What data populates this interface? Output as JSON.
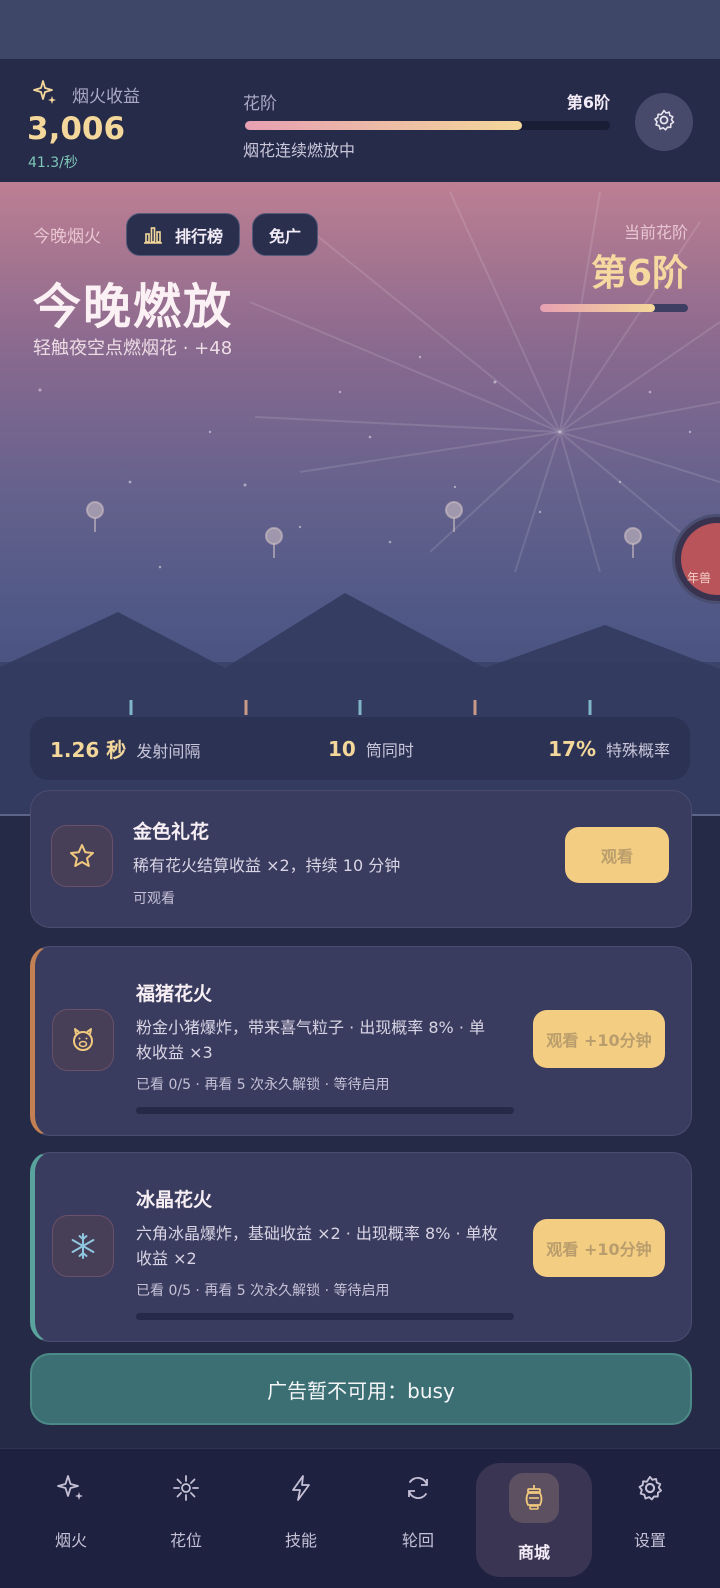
{
  "header": {
    "earnings_label": "烟火收益",
    "earnings_value": "3,006",
    "earnings_rate": "41.3/秒",
    "stage_title": "花阶",
    "stage_level": "第6阶",
    "stage_progress": 0.76,
    "stage_note": "烟花连续燃放中",
    "settings_icon": "gear-icon"
  },
  "hero": {
    "label": "今晚烟火",
    "leaderboard_label": "排行榜",
    "adfree_label": "免广",
    "title": "今晚燃放",
    "subtitle": "轻触夜空点燃烟花 · +48",
    "current_stage_label": "当前花阶",
    "current_stage_value": "第6阶",
    "current_stage_progress": 0.78,
    "float_badge_text": "年兽",
    "stats": [
      {
        "value": "1.26 秒",
        "label": "发射间隔"
      },
      {
        "value": "10",
        "label": "筒同时"
      },
      {
        "value": "17%",
        "label": "特殊概率"
      }
    ]
  },
  "cards": [
    {
      "title": "金色礼花",
      "icon": "star-icon",
      "desc_lines": [
        "稀有花火结算收益 ×2，持续 10 分钟"
      ],
      "meta": "可观看",
      "button": "观看"
    },
    {
      "title": "福猪花火",
      "icon": "pig-icon",
      "desc_lines": [
        "粉金小猪爆炸，带来喜气粒子 · 出现概率 8% · 单",
        "枚收益 ×3"
      ],
      "meta": "已看 0/5 · 再看 5 次永久解锁 · 等待启用",
      "progress": 0,
      "button": "观看 +10分钟"
    },
    {
      "title": "冰晶花火",
      "icon": "snowflake-icon",
      "desc_lines": [
        "六角冰晶爆炸，基础收益 ×2 · 出现概率 8% · 单枚",
        "收益 ×2"
      ],
      "meta": "已看 0/5 · 再看 5 次永久解锁 · 等待启用",
      "progress": 0,
      "button": "观看 +10分钟"
    }
  ],
  "toast": {
    "text": "广告暂不可用：busy"
  },
  "nav": [
    {
      "label": "烟火",
      "icon": "sparkle-icon"
    },
    {
      "label": "花位",
      "icon": "burst-icon"
    },
    {
      "label": "技能",
      "icon": "lightning-icon"
    },
    {
      "label": "轮回",
      "icon": "refresh-icon"
    },
    {
      "label": "商城",
      "icon": "lantern-icon",
      "active": true
    },
    {
      "label": "设置",
      "icon": "gear-icon"
    }
  ],
  "colors": {
    "accent_gold": "#f4d79a",
    "accent_pink": "#e7a0b2",
    "toast_teal": "#3b6f73",
    "background": "#252a47"
  }
}
